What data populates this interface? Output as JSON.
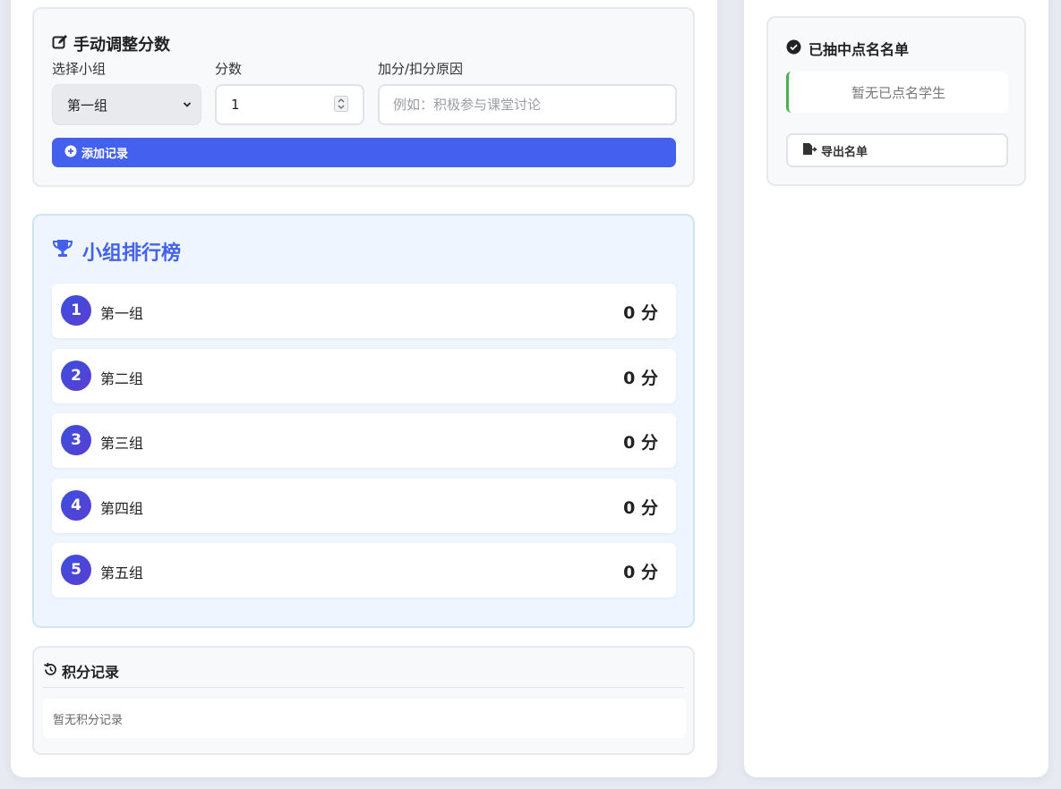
{
  "adjust": {
    "title": "手动调整分数",
    "group_label": "选择小组",
    "score_label": "分数",
    "reason_label": "加分/扣分原因",
    "selected_group": "第一组",
    "score_value": "1",
    "reason_placeholder": "例如：积极参与课堂讨论",
    "add_button": "添加记录"
  },
  "leaderboard": {
    "title": "小组排行榜",
    "rows": [
      {
        "rank": "1",
        "name": "第一组",
        "score": "0 分"
      },
      {
        "rank": "2",
        "name": "第二组",
        "score": "0 分"
      },
      {
        "rank": "3",
        "name": "第三组",
        "score": "0 分"
      },
      {
        "rank": "4",
        "name": "第四组",
        "score": "0 分"
      },
      {
        "rank": "5",
        "name": "第五组",
        "score": "0 分"
      }
    ]
  },
  "history": {
    "title": "积分记录",
    "empty_text": "暂无积分记录"
  },
  "picked": {
    "title": "已抽中点名名单",
    "empty_text": "暂无已点名学生",
    "export_button": "导出名单"
  },
  "colors": {
    "accent": "#4361ee",
    "success_border": "#4caf50"
  }
}
